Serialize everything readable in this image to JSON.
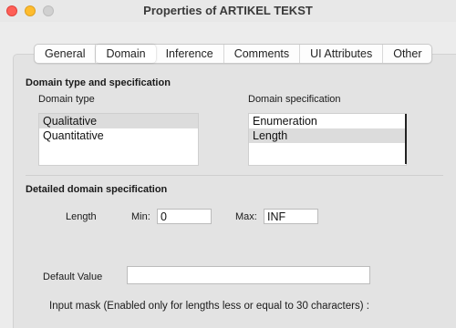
{
  "window": {
    "title": "Properties of ARTIKEL TEKST"
  },
  "tabs": [
    {
      "label": "General",
      "active": false
    },
    {
      "label": "Domain",
      "active": true
    },
    {
      "label": "Inference",
      "active": false
    },
    {
      "label": "Comments",
      "active": false
    },
    {
      "label": "UI Attributes",
      "active": false
    },
    {
      "label": "Other",
      "active": false
    }
  ],
  "domain_section": {
    "title": "Domain type and specification",
    "type_label": "Domain type",
    "spec_label": "Domain specification",
    "types": [
      "Qualitative",
      "Quantitative"
    ],
    "selected_type": "Qualitative",
    "specs": [
      "Enumeration",
      "Length"
    ],
    "selected_spec": "Length"
  },
  "detail_section": {
    "title": "Detailed domain specification",
    "length_label": "Length",
    "min_label": "Min:",
    "min_value": "0",
    "max_label": "Max:",
    "max_value": "INF",
    "default_label": "Default Value",
    "default_value": "",
    "input_mask_label": "Input mask (Enabled only for lengths less or equal to 30 characters) :"
  }
}
